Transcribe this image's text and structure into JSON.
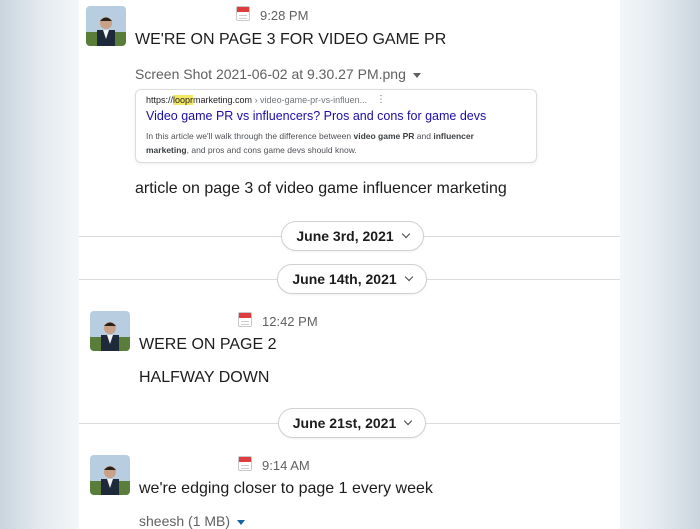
{
  "messages": [
    {
      "time": "9:28 PM",
      "text": "WE'RE ON PAGE 3 FOR VIDEO GAME PR",
      "attachment": {
        "filename": "Screen Shot 2021-06-02 at 9.30.27 PM.png",
        "preview": {
          "url_prefix": "https://",
          "url_highlight": "loopr",
          "url_domain": "marketing.com",
          "url_path": " › video-game-pr-vs-influen...",
          "kebab": "⋮",
          "title": "Video game PR vs influencers? Pros and cons for game devs",
          "snippet_1": "In this article we'll walk through the difference between ",
          "snippet_b1": "video game PR",
          "snippet_2": " and ",
          "snippet_b2": "influencer marketing",
          "snippet_3": ", and pros and cons game devs should know."
        }
      },
      "followup": "article on page 3 of video game influencer marketing"
    },
    {
      "time": "12:42 PM",
      "lines": [
        "WERE ON PAGE 2",
        "HALFWAY DOWN"
      ]
    },
    {
      "time": "9:14 AM",
      "text": "we're edging closer to page 1 every week",
      "file_label": "sheesh (1 MB)"
    }
  ],
  "date_dividers": [
    "June 3rd, 2021",
    "June 14th, 2021",
    "June 21st, 2021"
  ],
  "colors": {
    "link": "#1a0dab",
    "accent_blue": "#1264a3",
    "calendar_red": "#e03e3e"
  },
  "icons": [
    "calendar-icon",
    "chevron-down-icon",
    "caret-down-icon",
    "kebab-icon"
  ]
}
